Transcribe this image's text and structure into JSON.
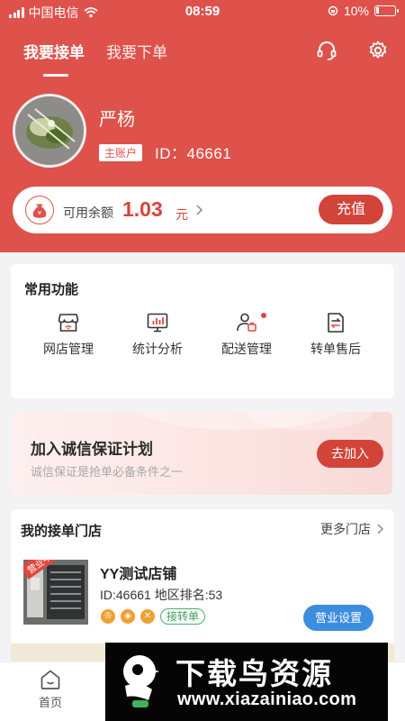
{
  "status_bar": {
    "carrier": "中国电信",
    "time": "08:59",
    "battery": "10%"
  },
  "header": {
    "tabs": [
      {
        "label": "我要接单",
        "active": true
      },
      {
        "label": "我要下单",
        "active": false
      }
    ],
    "icons": [
      "headset-icon",
      "gear-icon"
    ]
  },
  "profile": {
    "name": "严杨",
    "account_type": "主账户",
    "id_label": "ID：46661"
  },
  "balance": {
    "label": "可用余额",
    "value": "1.03",
    "unit": "元",
    "recharge_label": "充值"
  },
  "functions": {
    "title": "常用功能",
    "items": [
      {
        "label": "网店管理",
        "icon": "store-icon"
      },
      {
        "label": "统计分析",
        "icon": "chart-monitor-icon"
      },
      {
        "label": "配送管理",
        "icon": "delivery-person-icon",
        "has_dot": true
      },
      {
        "label": "转单售后",
        "icon": "transfer-icon"
      }
    ]
  },
  "promo": {
    "title": "加入诚信保证计划",
    "subtitle": "诚信保证是抢单必备条件之一",
    "button_label": "去加入"
  },
  "stores": {
    "title": "我的接单门店",
    "more_label": "更多门店",
    "items": [
      {
        "status_tag": "营业中",
        "name": "YY测试店铺",
        "meta": "ID:46661   地区排名:53",
        "badge_label": "接转单",
        "settings_label": "营业设置"
      }
    ]
  },
  "tabbar": {
    "home_label": "首页"
  },
  "watermark": {
    "title": "下载鸟资源",
    "url": "www.xiazainiao.com"
  },
  "colors": {
    "brand": "#de524b",
    "button_red": "#d24439",
    "blue": "#3b8de0",
    "green": "#4ab06a"
  }
}
